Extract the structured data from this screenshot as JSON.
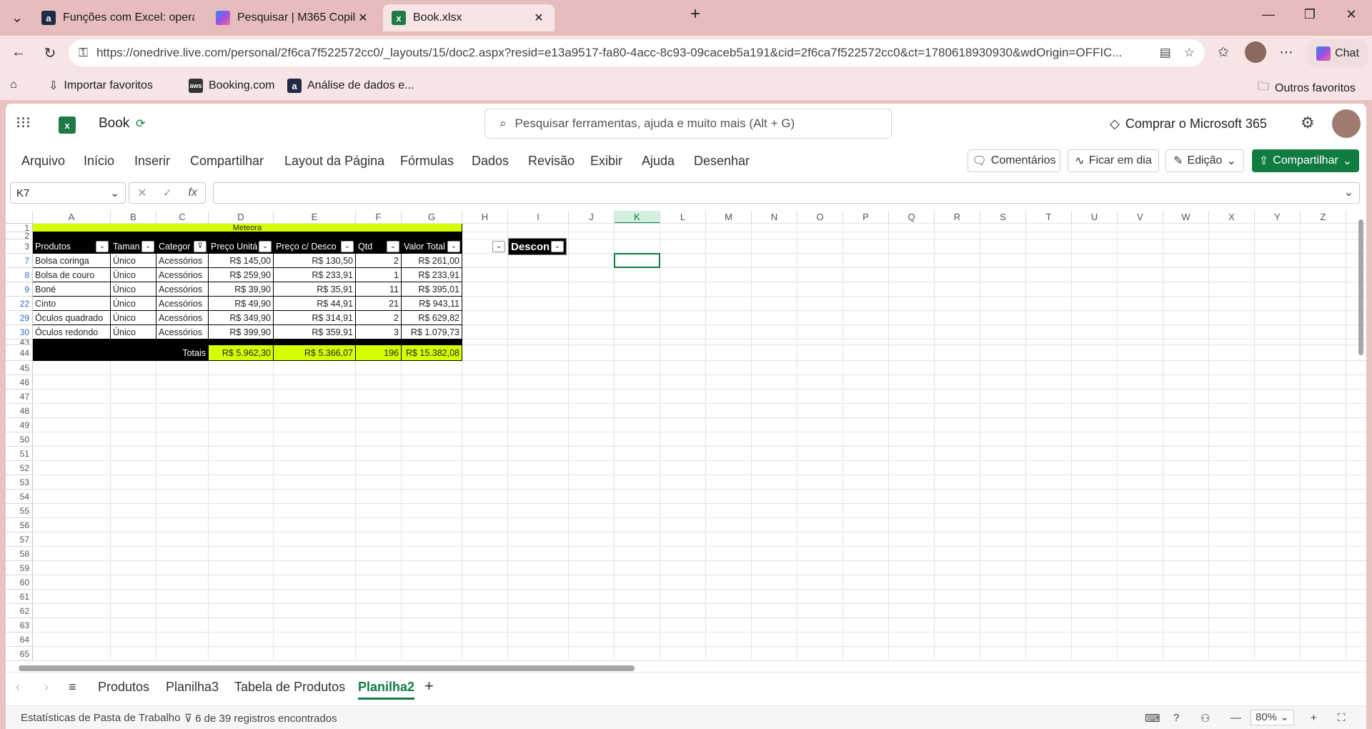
{
  "browser": {
    "tabs": [
      {
        "title": "Funções com Excel: operações mat",
        "icon": "a"
      },
      {
        "title": "Pesquisar | M365 Copilot",
        "icon": "copilot"
      },
      {
        "title": "Book.xlsx",
        "icon": "excel"
      }
    ],
    "url": "https://onedrive.live.com/personal/2f6ca7f522572cc0/_layouts/15/doc2.aspx?resid=e13a9517-fa80-4acc-8c93-09caceb5a191&cid=2f6ca7f522572cc0&ct=1780618930930&wdOrigin=OFFIC...",
    "chat_label": "Chat",
    "bookmarks": [
      "Importar favoritos",
      "Booking.com",
      "Análise de dados e..."
    ],
    "other_favorites": "Outros favoritos"
  },
  "excel": {
    "doc_title": "Book",
    "search_placeholder": "Pesquisar ferramentas, ajuda e muito mais (Alt + G)",
    "buy_label": "Comprar o Microsoft 365",
    "ribbon_tabs": [
      "Arquivo",
      "Início",
      "Inserir",
      "Compartilhar",
      "Layout da Página",
      "Fórmulas",
      "Dados",
      "Revisão",
      "Exibir",
      "Ajuda",
      "Desenhar"
    ],
    "comments_label": "Comentários",
    "catchup_label": "Ficar em dia",
    "editing_label": "Edição",
    "share_label": "Compartilhar",
    "namebox": "K7",
    "fx_label": "fx",
    "columns": [
      "A",
      "B",
      "C",
      "D",
      "E",
      "F",
      "G",
      "H",
      "I",
      "J",
      "K",
      "L",
      "M",
      "N",
      "O",
      "P",
      "Q",
      "R",
      "S",
      "T",
      "U",
      "V",
      "W",
      "X",
      "Y",
      "Z"
    ],
    "selected_column": "K",
    "row_headers": [
      "1",
      "2",
      "3",
      "7",
      "8",
      "9",
      "22",
      "29",
      "30",
      "43",
      "44",
      "45",
      "46",
      "47",
      "48",
      "49",
      "50",
      "51",
      "52",
      "53",
      "54",
      "55",
      "56",
      "57",
      "58",
      "59",
      "60",
      "61",
      "62",
      "63",
      "64",
      "65"
    ],
    "table_title": "Meteora",
    "headers": [
      "Produtos",
      "Taman",
      "Categor",
      "Preço Unitá",
      "Preço c/ Desco",
      "Qtd",
      "Valor Total"
    ],
    "rows": [
      [
        "Bolsa coringa",
        "Único",
        "Acessórios",
        "R$ 145,00",
        "R$ 130,50",
        "2",
        "R$ 261,00"
      ],
      [
        "Bolsa de couro",
        "Único",
        "Acessórios",
        "R$ 259,90",
        "R$ 233,91",
        "1",
        "R$ 233,91"
      ],
      [
        "Boné",
        "Único",
        "Acessórios",
        "R$ 39,90",
        "R$ 35,91",
        "11",
        "R$ 395,01"
      ],
      [
        "Cinto",
        "Único",
        "Acessórios",
        "R$ 49,90",
        "R$ 44,91",
        "21",
        "R$ 943,11"
      ],
      [
        "Óculos quadrado",
        "Único",
        "Acessórios",
        "R$ 349,90",
        "R$ 314,91",
        "2",
        "R$ 629,82"
      ],
      [
        "Óculos redondo",
        "Único",
        "Acessórios",
        "R$ 399,90",
        "R$ 359,91",
        "3",
        "R$ 1.079,73"
      ]
    ],
    "totals_label": "Totais",
    "totals": [
      "R$ 5.962,30",
      "R$ 5.366,07",
      "196",
      "R$ 15.382,08"
    ],
    "desconto_header": "Descon",
    "sheet_tabs": [
      "Produtos",
      "Planilha3",
      "Tabela de Produtos",
      "Planilha2"
    ],
    "active_sheet": "Planilha2",
    "status_left": "Estatísticas de Pasta de Trabalho",
    "status_filter": "6 de 39 registros encontrados",
    "zoom": "80%"
  }
}
